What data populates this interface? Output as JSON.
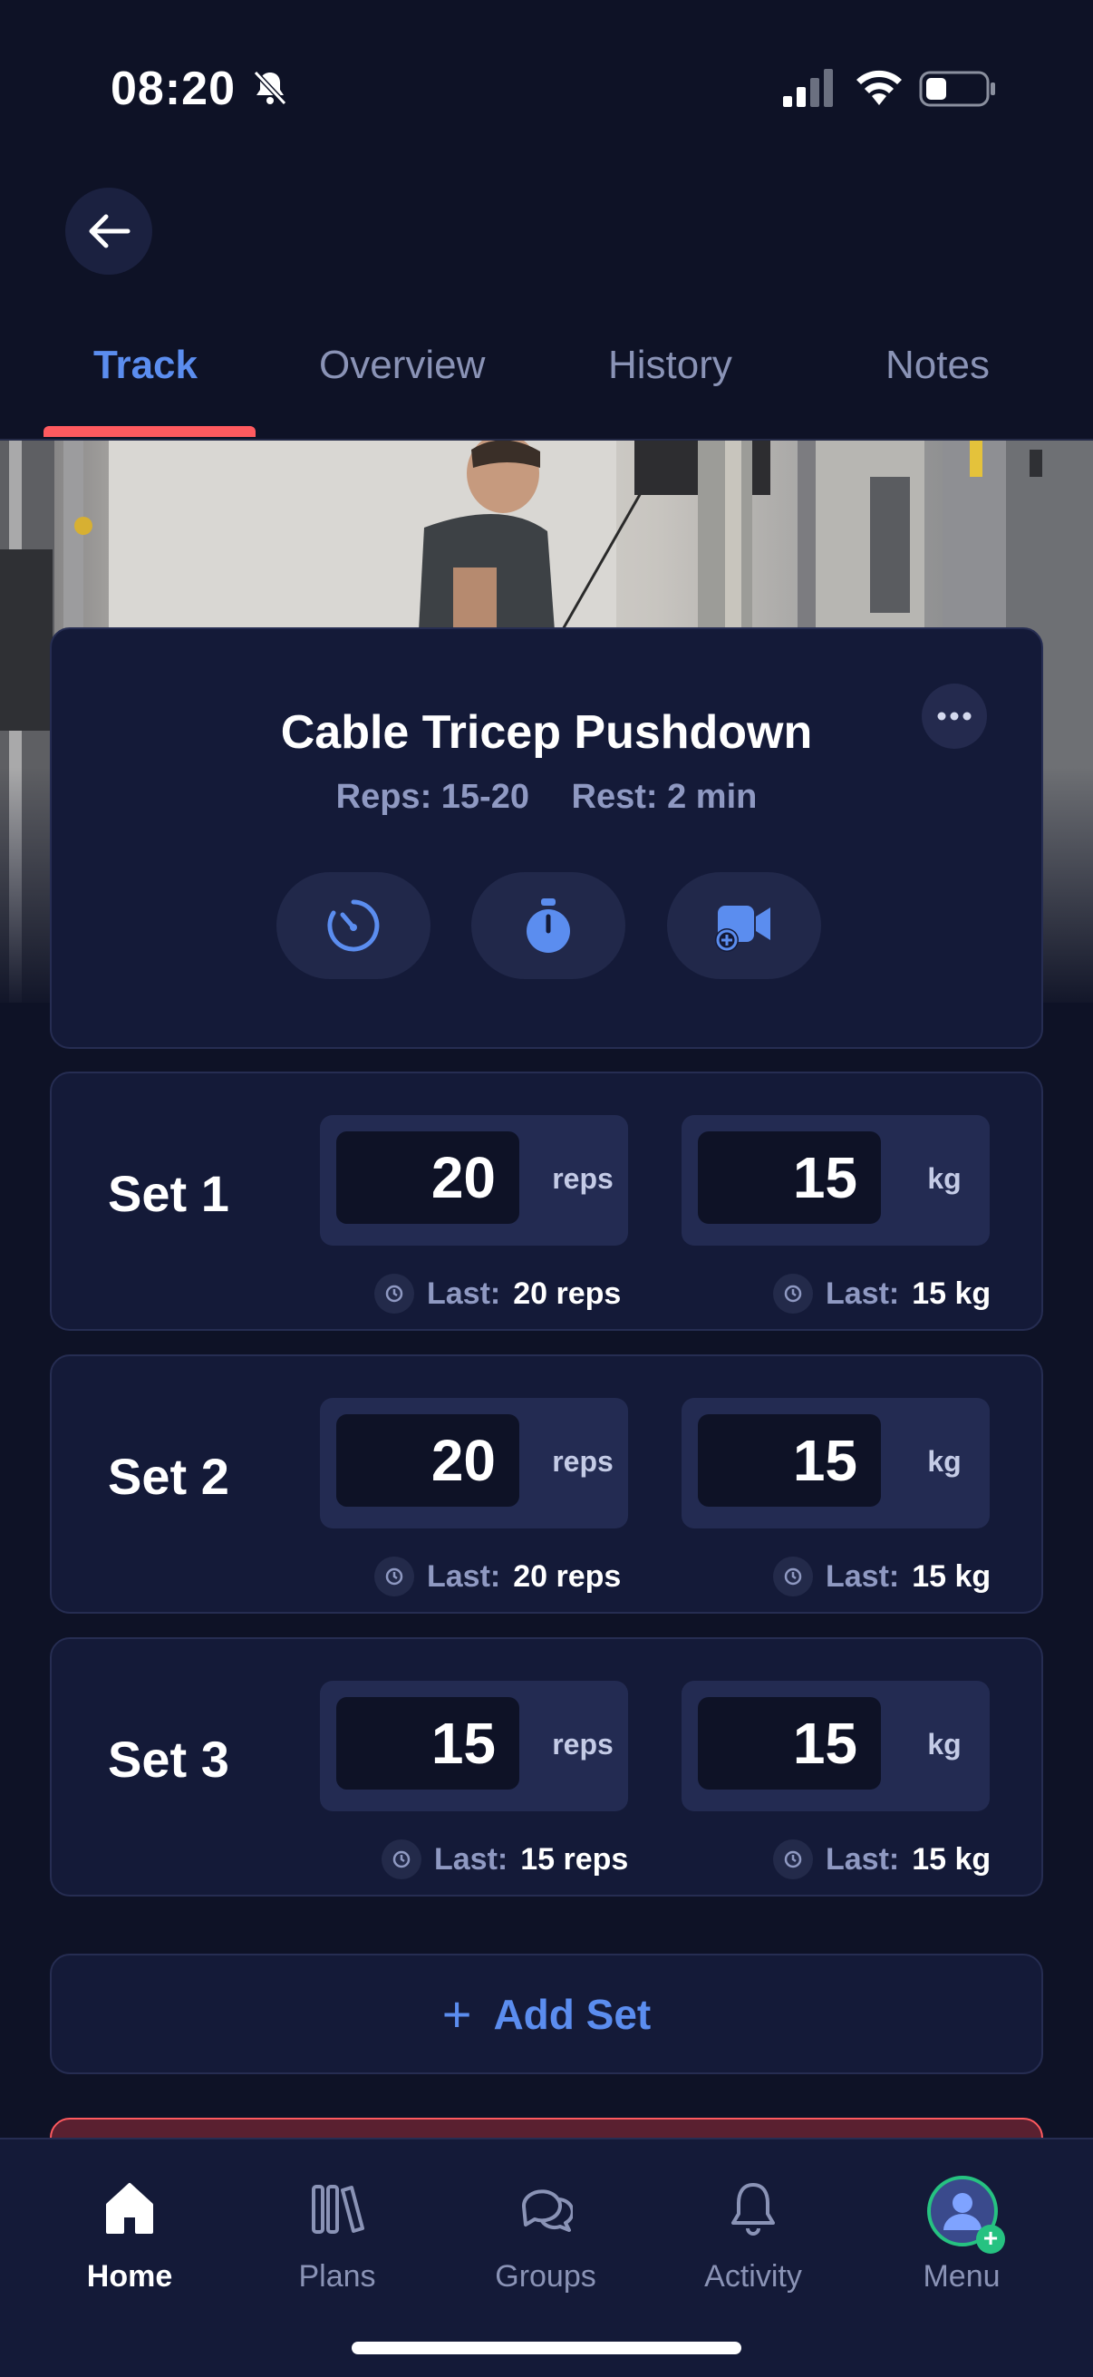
{
  "status_bar": {
    "time": "08:20"
  },
  "tabs": [
    {
      "label": "Track",
      "active": true
    },
    {
      "label": "Overview",
      "active": false
    },
    {
      "label": "History",
      "active": false
    },
    {
      "label": "Notes",
      "active": false
    }
  ],
  "exercise": {
    "title": "Cable Tricep Pushdown",
    "reps": "Reps: 15-20",
    "rest": "Rest: 2 min",
    "tools": [
      "speedometer-icon",
      "stopwatch-icon",
      "add-video-icon"
    ]
  },
  "sets": [
    {
      "label": "Set 1",
      "reps": "20",
      "reps_unit": "reps",
      "weight": "15",
      "weight_unit": "kg",
      "last_label": "Last:",
      "last_reps": "20 reps",
      "last_weight": "15 kg"
    },
    {
      "label": "Set 2",
      "reps": "20",
      "reps_unit": "reps",
      "weight": "15",
      "weight_unit": "kg",
      "last_label": "Last:",
      "last_reps": "20 reps",
      "last_weight": "15 kg"
    },
    {
      "label": "Set 3",
      "reps": "15",
      "reps_unit": "reps",
      "weight": "15",
      "weight_unit": "kg",
      "last_label": "Last:",
      "last_reps": "15 reps",
      "last_weight": "15 kg"
    }
  ],
  "add_set": {
    "label": "Add Set"
  },
  "bottom_nav": [
    {
      "label": "Home",
      "icon": "home-icon",
      "active": true
    },
    {
      "label": "Plans",
      "icon": "plans-icon",
      "active": false
    },
    {
      "label": "Groups",
      "icon": "groups-icon",
      "active": false
    },
    {
      "label": "Activity",
      "icon": "bell-icon",
      "active": false
    },
    {
      "label": "Menu",
      "icon": "avatar",
      "active": false
    }
  ],
  "colors": {
    "background": "#0e1226",
    "card": "#141a38",
    "accent": "#5b8def",
    "indicator": "#ff5a5f",
    "success": "#26c281"
  }
}
